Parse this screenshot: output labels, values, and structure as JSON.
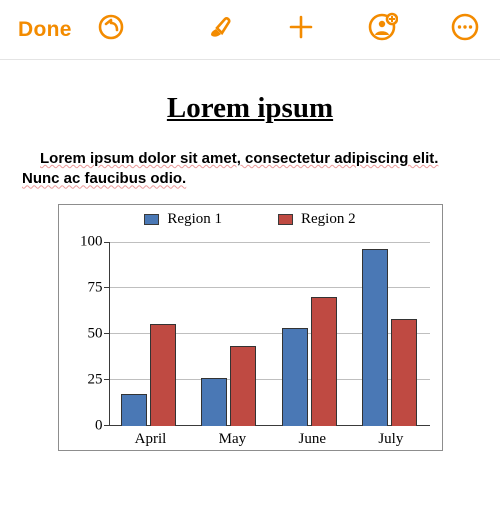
{
  "toolbar": {
    "done_label": "Done"
  },
  "doc": {
    "title": "Lorem ipsum ",
    "body": "Lorem ipsum dolor sit amet, consectetur adipiscing elit. Nunc ac faucibus odio."
  },
  "chart_data": {
    "type": "bar",
    "categories": [
      "April",
      "May",
      "June",
      "July"
    ],
    "series": [
      {
        "name": "Region 1",
        "values": [
          17,
          26,
          53,
          96
        ]
      },
      {
        "name": "Region 2",
        "values": [
          55,
          43,
          70,
          58
        ]
      }
    ],
    "title": "",
    "xlabel": "",
    "ylabel": "",
    "ylim": [
      0,
      100
    ],
    "yticks": [
      0,
      25,
      50,
      75,
      100
    ],
    "colors": {
      "Region 1": "#4a78b5",
      "Region 2": "#bf4a42"
    }
  }
}
